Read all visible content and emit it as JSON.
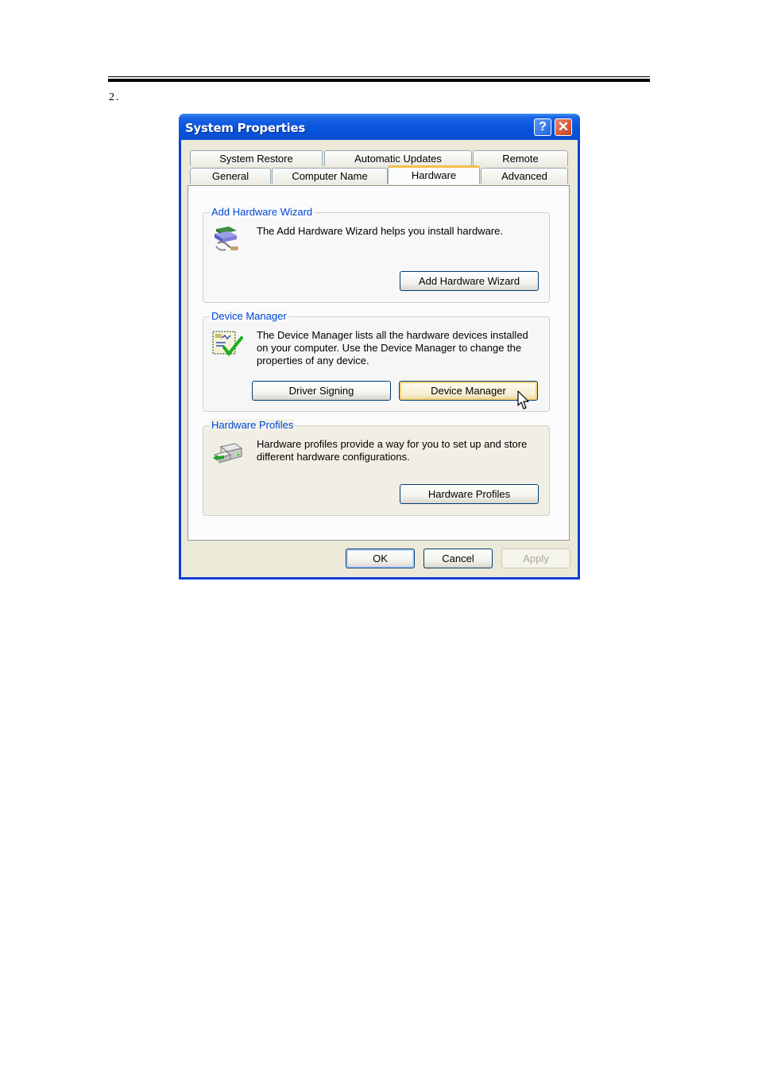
{
  "document": {
    "step_number": "2."
  },
  "window": {
    "title": "System Properties",
    "help_button_glyph": "?",
    "close_button_glyph": "✕"
  },
  "tabs": {
    "row_back": [
      {
        "label": "System Restore"
      },
      {
        "label": "Automatic Updates"
      },
      {
        "label": "Remote"
      }
    ],
    "row_front": [
      {
        "label": "General"
      },
      {
        "label": "Computer Name"
      },
      {
        "label": "Hardware",
        "active": true
      },
      {
        "label": "Advanced"
      }
    ]
  },
  "groups": {
    "add_hardware": {
      "legend": "Add Hardware Wizard",
      "icon": "add-hardware-wizard-icon",
      "description": "The Add Hardware Wizard helps you install hardware.",
      "button": "Add Hardware Wizard"
    },
    "device_manager": {
      "legend": "Device Manager",
      "icon": "device-manager-icon",
      "description_lines": [
        "The Device Manager lists all the hardware devices installed",
        "on your computer. Use the Device Manager to change the",
        "properties of any device."
      ],
      "buttons": {
        "driver_signing": "Driver Signing",
        "device_manager": "Device Manager"
      }
    },
    "hardware_profiles": {
      "legend": "Hardware Profiles",
      "icon": "hardware-profiles-icon",
      "description_lines": [
        "Hardware profiles provide a way for you to set up and store",
        "different hardware configurations."
      ],
      "button": "Hardware Profiles"
    }
  },
  "footer": {
    "ok": "OK",
    "cancel": "Cancel",
    "apply": "Apply",
    "apply_enabled": false
  },
  "colors": {
    "titlebar": "#0a56de",
    "group_legend": "#0046d5",
    "active_tab_highlight": "#f4c04c",
    "dialog_face": "#ece9d8"
  }
}
